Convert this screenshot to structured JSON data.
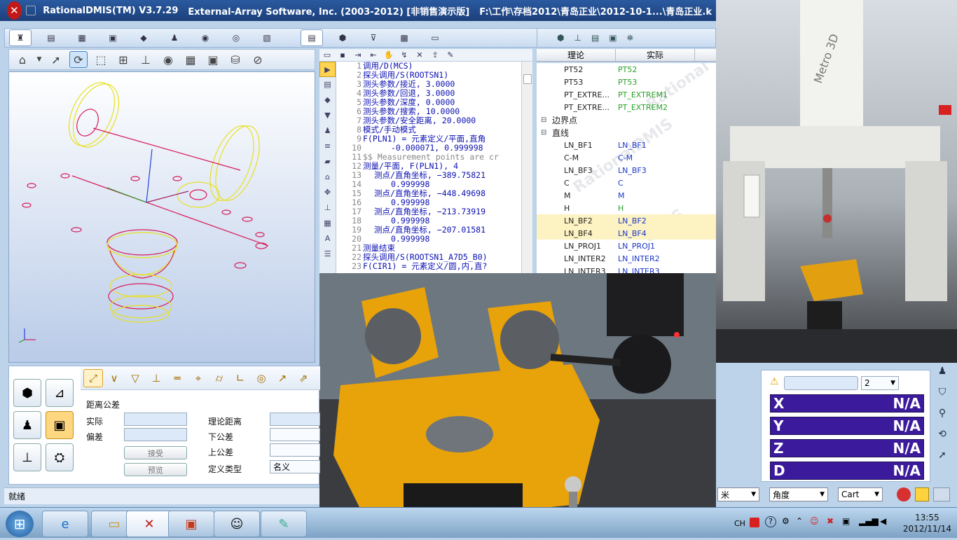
{
  "window": {
    "title_app": "RationalDMIS(TM) V3.7.29",
    "title_company": "External-Array Software, Inc. (2003-2012) [非销售演示版]",
    "title_path": "F:\\工作\\存档2012\\青岛正业\\2012-10-1...\\青岛正业.k"
  },
  "editor": {
    "lines": [
      {
        "n": "1",
        "t": "调用/D(MCS)",
        "style": "code"
      },
      {
        "n": "2",
        "t": "探头调用/S(ROOTSN1)",
        "style": "code"
      },
      {
        "n": "3",
        "t": "测头参数/接近, 3.0000",
        "style": "code"
      },
      {
        "n": "4",
        "t": "测头参数/回退, 3.0000",
        "style": "code"
      },
      {
        "n": "5",
        "t": "测头参数/深度, 0.0000",
        "style": "code"
      },
      {
        "n": "6",
        "t": "测头参数/搜索, 10.0000",
        "style": "code"
      },
      {
        "n": "7",
        "t": "测头参数/安全距离, 20.0000",
        "style": "code"
      },
      {
        "n": "8",
        "t": "模式/手动模式",
        "style": "code"
      },
      {
        "n": "9",
        "t": "F(PLN1) = 元素定义/平面,直角",
        "style": "code"
      },
      {
        "n": "10",
        "t": "-0.000071, 0.999998",
        "style": "code ind2"
      },
      {
        "n": "11",
        "t": "$$ Measurement points are cr",
        "style": "code cmt"
      },
      {
        "n": "12",
        "t": "测量/平面, F(PLN1), 4",
        "style": "code"
      },
      {
        "n": "13",
        "t": "测点/直角坐标,  −389.75821",
        "style": "code ind"
      },
      {
        "n": "14",
        "t": "0.999998",
        "style": "code ind2"
      },
      {
        "n": "15",
        "t": "测点/直角坐标,  −448.49698",
        "style": "code ind"
      },
      {
        "n": "16",
        "t": "0.999998",
        "style": "code ind2"
      },
      {
        "n": "17",
        "t": "测点/直角坐标,  −213.73919",
        "style": "code ind"
      },
      {
        "n": "18",
        "t": "0.999998",
        "style": "code ind2"
      },
      {
        "n": "19",
        "t": "测点/直角坐标,  −207.01581",
        "style": "code ind"
      },
      {
        "n": "20",
        "t": "0.999998",
        "style": "code ind2"
      },
      {
        "n": "21",
        "t": "测量结束",
        "style": "code"
      },
      {
        "n": "22",
        "t": "探头调用/S(ROOTSN1_A7D5_B0)",
        "style": "code"
      },
      {
        "n": "23",
        "t": "F(CIR1) = 元素定义/圆,内,直?",
        "style": "code"
      }
    ]
  },
  "tree": {
    "header_nominal": "理论",
    "header_actual": "实际",
    "rows": [
      {
        "a": "PT52",
        "b": "PT52",
        "kind": "g"
      },
      {
        "a": "PT53",
        "b": "PT53",
        "kind": "g"
      },
      {
        "a": "PT_EXTRE...",
        "b": "PT_EXTREM1",
        "kind": "g"
      },
      {
        "a": "PT_EXTRE...",
        "b": "PT_EXTREM2",
        "kind": "g"
      },
      {
        "a": "边界点",
        "b": "",
        "kind": "grp"
      },
      {
        "a": "直线",
        "b": "",
        "kind": "grp"
      },
      {
        "a": "LN_BF1",
        "b": "LN_BF1",
        "kind": "n"
      },
      {
        "a": "C-M",
        "b": "C-M",
        "kind": "n"
      },
      {
        "a": "LN_BF3",
        "b": "LN_BF3",
        "kind": "n"
      },
      {
        "a": "C",
        "b": "C",
        "kind": "n"
      },
      {
        "a": "M",
        "b": "M",
        "kind": "n"
      },
      {
        "a": "H",
        "b": "H",
        "kind": "g"
      },
      {
        "a": "LN_BF2",
        "b": "LN_BF2",
        "kind": "sel"
      },
      {
        "a": "LN_BF4",
        "b": "LN_BF4",
        "kind": "sel"
      },
      {
        "a": "LN_PROJ1",
        "b": "LN_PROJ1",
        "kind": "n"
      },
      {
        "a": "LN_INTER2",
        "b": "LN_INTER2",
        "kind": "n"
      },
      {
        "a": "LN_INTER3",
        "b": "LN_INTER3",
        "kind": "n"
      }
    ]
  },
  "tolerance": {
    "section_title": "距离公差",
    "actual_label": "实际",
    "deviation_label": "偏差",
    "accept_button": "接受",
    "preview_button": "预览",
    "nominal_distance_label": "理论距离",
    "lower_tol_label": "下公差",
    "upper_tol_label": "上公差",
    "def_type_label": "定义类型",
    "def_type_value": "名义"
  },
  "status": {
    "text": "就绪",
    "unit_value": "米",
    "angle_value": "角度",
    "coord_value": "Cart"
  },
  "dro": {
    "count_value": "2",
    "rows": [
      {
        "axis": "X",
        "value": "N/A"
      },
      {
        "axis": "Y",
        "value": "N/A"
      },
      {
        "axis": "Z",
        "value": "N/A"
      },
      {
        "axis": "D",
        "value": "N/A"
      }
    ]
  },
  "cmm": {
    "brand": "Metro 3D"
  },
  "taskbar": {
    "lang": "CH",
    "time": "13:55",
    "date": "2012/11/14"
  },
  "colors": {
    "dro_bg": "#3b1a9c",
    "titlebar": "#2b5aa0",
    "part_yellow": "#e8a20a"
  }
}
